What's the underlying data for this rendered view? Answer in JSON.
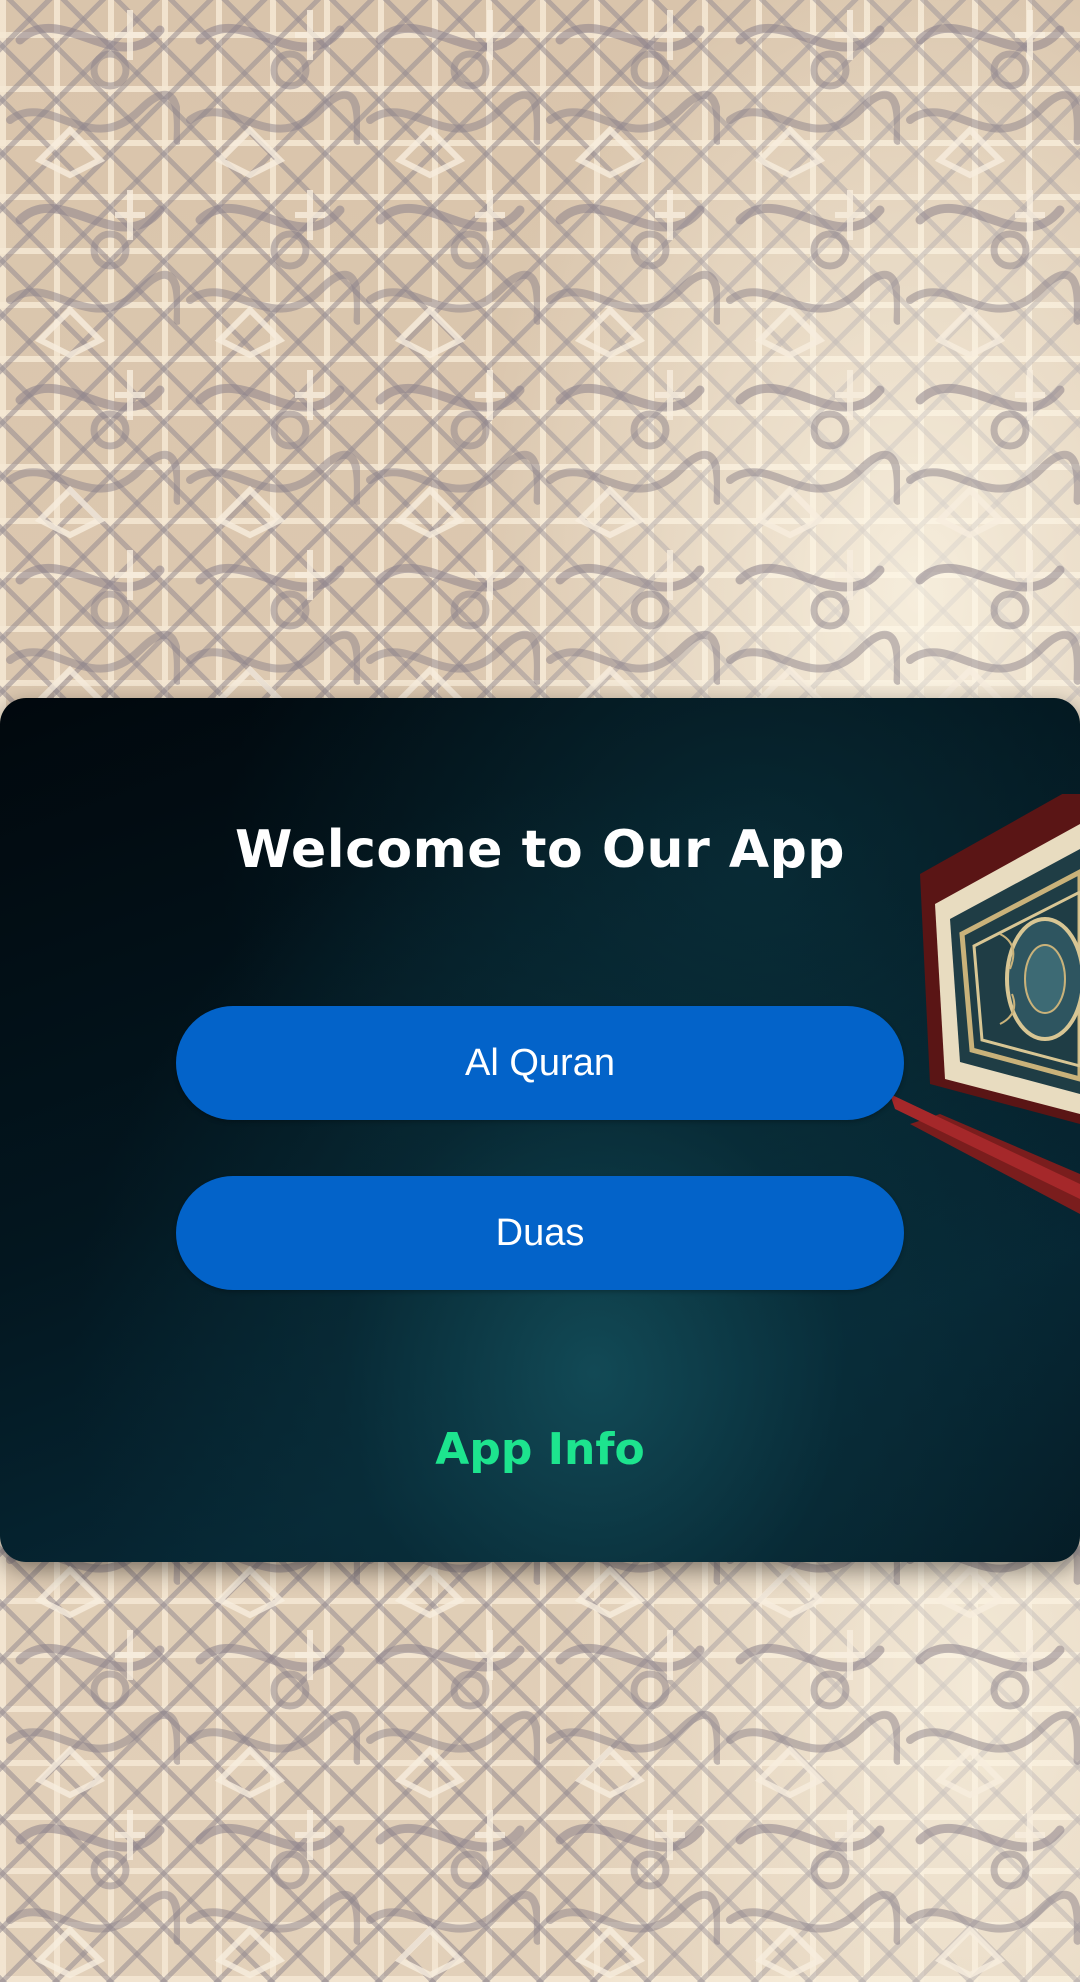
{
  "welcome": {
    "title": "Welcome to Our App"
  },
  "menu": {
    "quran_label": "Al Quran",
    "duas_label": "Duas"
  },
  "footer": {
    "app_info_label": "App Info"
  },
  "colors": {
    "button": "#0363c9",
    "app_info": "#1de48e",
    "title": "#ffffff",
    "card_dark": "#01080d"
  },
  "icons": {
    "background": "islamic-calligraphy-pattern",
    "card_art": "quran-book-icon"
  }
}
